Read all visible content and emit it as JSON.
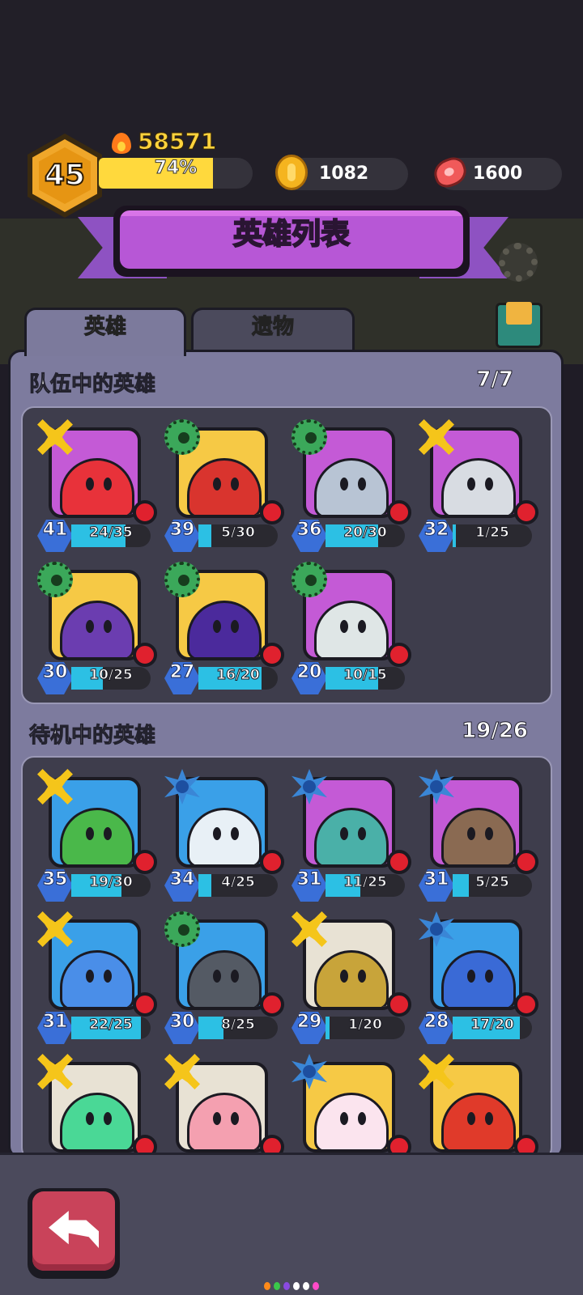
{
  "header": {
    "level": "45",
    "power": "58571",
    "xp_percent_label": "74%",
    "xp_fraction": 0.74,
    "gold": "1082",
    "meat": "1600"
  },
  "banner": {
    "title": "英雄列表"
  },
  "tabs": [
    {
      "label": "英雄",
      "active": true
    },
    {
      "label": "遗物",
      "active": false
    }
  ],
  "team": {
    "title": "队伍中的英雄",
    "count": "7/7",
    "heroes": [
      {
        "level": "41",
        "shards": "24/35",
        "progress": 0.686,
        "badge": "bone",
        "bg": "#c45ad6",
        "body": "#e8323a"
      },
      {
        "level": "39",
        "shards": "5/30",
        "progress": 0.167,
        "badge": "skull",
        "bg": "#f6c945",
        "body": "#d9342e"
      },
      {
        "level": "36",
        "shards": "20/30",
        "progress": 0.667,
        "badge": "skull",
        "bg": "#c45ad6",
        "body": "#b8c4d4"
      },
      {
        "level": "32",
        "shards": "1/25",
        "progress": 0.04,
        "badge": "bone",
        "bg": "#c45ad6",
        "body": "#d8dce2"
      },
      {
        "level": "30",
        "shards": "10/25",
        "progress": 0.4,
        "badge": "skull",
        "bg": "#f6c945",
        "body": "#6b3db0"
      },
      {
        "level": "27",
        "shards": "16/20",
        "progress": 0.8,
        "badge": "skull",
        "bg": "#f6c945",
        "body": "#4b2a9c"
      },
      {
        "level": "20",
        "shards": "10/15",
        "progress": 0.667,
        "badge": "skull",
        "bg": "#c45ad6",
        "body": "#dfe6e6"
      }
    ]
  },
  "standby": {
    "title": "待机中的英雄",
    "count": "19/26",
    "heroes": [
      {
        "level": "35",
        "shards": "19/30",
        "progress": 0.633,
        "badge": "bone",
        "bg": "#3aa0e8",
        "body": "#4ab84a"
      },
      {
        "level": "34",
        "shards": "4/25",
        "progress": 0.16,
        "badge": "ice",
        "bg": "#3aa0e8",
        "body": "#e8f0f6"
      },
      {
        "level": "31",
        "shards": "11/25",
        "progress": 0.44,
        "badge": "ice",
        "bg": "#c45ad6",
        "body": "#4ab0a8"
      },
      {
        "level": "31",
        "shards": "5/25",
        "progress": 0.2,
        "badge": "ice",
        "bg": "#c45ad6",
        "body": "#8a6a52"
      },
      {
        "level": "31",
        "shards": "22/25",
        "progress": 0.88,
        "badge": "bone",
        "bg": "#3aa0e8",
        "body": "#4a8ee8"
      },
      {
        "level": "30",
        "shards": "8/25",
        "progress": 0.32,
        "badge": "skull",
        "bg": "#3aa0e8",
        "body": "#545a64"
      },
      {
        "level": "29",
        "shards": "1/20",
        "progress": 0.05,
        "badge": "bone",
        "bg": "#e8e2d4",
        "body": "#c8a43a"
      },
      {
        "level": "28",
        "shards": "17/20",
        "progress": 0.85,
        "badge": "ice",
        "bg": "#3aa0e8",
        "body": "#3a6ad6"
      },
      {
        "level": "",
        "shards": "",
        "progress": 0,
        "badge": "bone",
        "bg": "#e8e2d4",
        "body": "#4ad896"
      },
      {
        "level": "",
        "shards": "",
        "progress": 0,
        "badge": "bone",
        "bg": "#e8e2d4",
        "body": "#f4a0b0"
      },
      {
        "level": "",
        "shards": "",
        "progress": 0,
        "badge": "ice",
        "bg": "#f6c945",
        "body": "#fbe4ee"
      },
      {
        "level": "",
        "shards": "",
        "progress": 0,
        "badge": "bone",
        "bg": "#f6c945",
        "body": "#e03a2a"
      }
    ]
  },
  "colors": {
    "accent_purple": "#b757d6",
    "panel": "#7d7b9e",
    "shard_fill": "#2cc0e4",
    "level_blue": "#3a6fd8",
    "alert_red": "#e0212e"
  },
  "page_dots": [
    "#ff8a1a",
    "#3ac84a",
    "#8a4ae0",
    "#ffffff",
    "#ffffff",
    "#ff4ac8"
  ]
}
